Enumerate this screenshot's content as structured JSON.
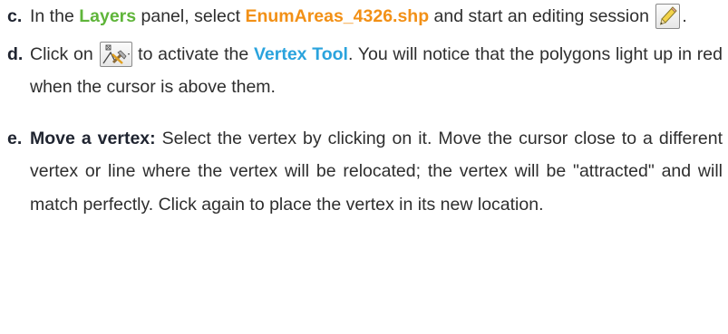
{
  "steps": {
    "c": {
      "marker": "c.",
      "t1": "In the ",
      "layers": "Layers",
      "t2": " panel, select ",
      "file": "EnumAreas_4326.shp",
      "t3": " and start an editing session",
      "end": ".",
      "icon": "pencil-icon"
    },
    "d": {
      "marker": "d.",
      "t1": "Click on ",
      "t2": " to activate the ",
      "tool": "Vertex Tool",
      "t3": ". You will notice that the polygons light up in red when the cursor is above them.",
      "icon": "vertex-tool-icon"
    },
    "e": {
      "marker": "e.",
      "lead": "Move a vertex:",
      "text": " Select the vertex by clicking on it. Move the cursor close to a different vertex or line where the vertex will be relocated; the vertex will be \"attracted\" and will match perfectly. Click again to place the vertex in its new location."
    }
  },
  "colors": {
    "text": "#2e2e2e",
    "layers": "#5fb53a",
    "file": "#f29016",
    "tool": "#2aa3dd"
  }
}
